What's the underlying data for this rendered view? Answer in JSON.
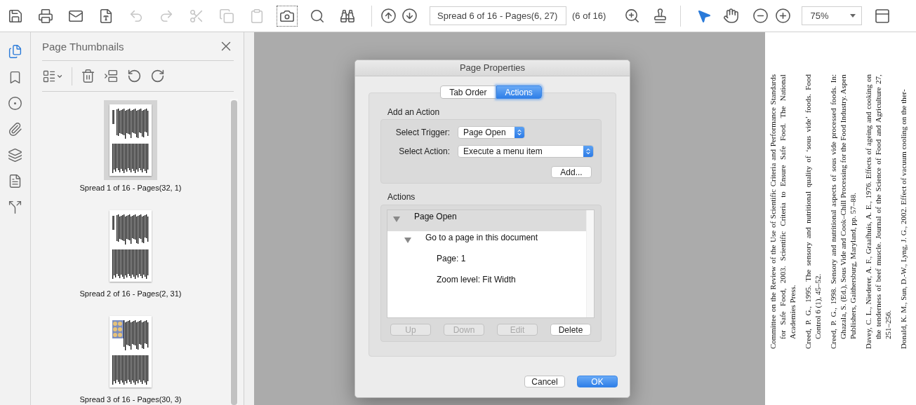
{
  "toolbar": {
    "tools": [
      {
        "disabled": false,
        "selected": false
      },
      {
        "disabled": false,
        "selected": false
      },
      {
        "disabled": false,
        "selected": false
      },
      {
        "disabled": false,
        "selected": false
      },
      {
        "disabled": true,
        "selected": false
      },
      {
        "disabled": true,
        "selected": false
      },
      {
        "disabled": true,
        "selected": false
      },
      {
        "disabled": true,
        "selected": false
      },
      {
        "disabled": true,
        "selected": false
      },
      {
        "disabled": false,
        "selected": true
      },
      {
        "disabled": false,
        "selected": false
      },
      {
        "disabled": false,
        "selected": false
      }
    ],
    "page_field": {
      "value": "Spread 6 of 16 - Pages(6, 27)"
    },
    "page_count": "(6 of 16)",
    "pointer_tools": [
      {
        "selected": true
      },
      {
        "selected": false
      }
    ],
    "zoom": {
      "value": "75%"
    }
  },
  "rail": [
    {
      "selected": true
    },
    {
      "selected": false
    },
    {
      "selected": false
    },
    {
      "selected": false
    },
    {
      "selected": false
    },
    {
      "selected": false
    },
    {
      "selected": false
    }
  ],
  "panel": {
    "title": "Page Thumbnails",
    "thumbnails": [
      {
        "label": "Spread 1 of 16 - Pages(32, 1)",
        "selected": true,
        "kind": "text"
      },
      {
        "label": "Spread 2 of 16 - Pages(2, 31)",
        "selected": false,
        "kind": "text"
      },
      {
        "label": "Spread 3 of 16 - Pages(30, 3)",
        "selected": false,
        "kind": "photo"
      }
    ]
  },
  "dialog": {
    "title": "Page Properties",
    "tabs": [
      {
        "label": "Tab Order",
        "selected": false
      },
      {
        "label": "Actions",
        "selected": true
      }
    ],
    "add_section": {
      "title": "Add an Action",
      "selects": [
        {
          "label": "Select Trigger:",
          "value": "Page Open",
          "kind": "short"
        },
        {
          "label": "Select Action:",
          "value": "Execute a menu item",
          "kind": "wide"
        }
      ],
      "add_button": "Add..."
    },
    "actions_section": {
      "title": "Actions",
      "tree": [
        {
          "label": "Page Open",
          "expanded": true,
          "selected": true,
          "children": [
            {
              "label": "Go to a page in this document",
              "expanded": true,
              "selected": false,
              "children": [
                {
                  "label": "Page: 1",
                  "selected": false
                },
                {
                  "label": "Zoom level: Fit Width",
                  "selected": false
                }
              ]
            }
          ]
        }
      ],
      "buttons": [
        {
          "label": "Up",
          "disabled": true
        },
        {
          "label": "Down",
          "disabled": true
        },
        {
          "label": "Edit",
          "disabled": true
        },
        {
          "label": "Delete",
          "disabled": false
        }
      ]
    },
    "footer": [
      {
        "label": "Cancel",
        "default": false
      },
      {
        "label": "OK",
        "default": true
      }
    ]
  },
  "document": {
    "references": [
      "Committee on the Review of the Use of Scientific Criteria and Performance Standards for Safe Food, 2003. Scientific Criteria to Ensure Safe Food. The National Academies Press.",
      "Creed, P. G., 1995. The sensory and nutritional quality of ‘sous vide’ foods. Food Control 6 (1), 45–52.",
      "Creed, P. G., 1998. Sensory and nutritional aspects of sous vide processed foods. In: Ghazala, S. (Ed.), Sous Vide and Cook–Chill Processing for the Food Industry. Aspen Publishers, Gaithersburg, Maryland, pp. 57–88.",
      "Davey, C. L., Niederer, A. F., Graafhuis, A. E., 1976. Effects of ageing and cooking on the tenderness of beef muscle. Journal of the Science of Food and Agriculture 27, 251–256.",
      "Donald, K. M., Sun, D.-W., Lyng, J. G., 2002. Effect of vacuum cooling on the ther-"
    ]
  }
}
